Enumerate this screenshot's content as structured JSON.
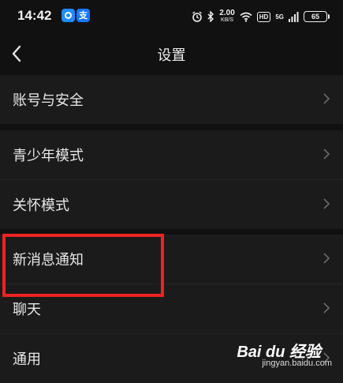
{
  "status_bar": {
    "time": "14:42",
    "app2_glyph": "支",
    "speed_value": "2.00",
    "speed_unit": "KB/S",
    "hd_label": "HD",
    "signal_label": "5G",
    "battery_level": "65",
    "icons": [
      "alarm-icon",
      "bluetooth-icon",
      "wifi-icon",
      "signal-icon"
    ]
  },
  "header": {
    "title": "设置",
    "back_icon": "chevron-left-icon"
  },
  "groups": [
    {
      "items": [
        {
          "label": "账号与安全"
        }
      ]
    },
    {
      "items": [
        {
          "label": "青少年模式"
        },
        {
          "label": "关怀模式"
        }
      ]
    },
    {
      "items": [
        {
          "label": "新消息通知"
        },
        {
          "label": "聊天"
        },
        {
          "label": "通用"
        }
      ]
    }
  ],
  "highlight": {
    "color": "#ee2222",
    "target": "新消息通知"
  },
  "watermark": {
    "logo": "Bai du 经验",
    "url": "jingyan.baidu.com"
  },
  "colors": {
    "background": "#111111",
    "row_background": "#1b1b1b",
    "text": "#e8e8e8",
    "chevron": "#6a6a6a"
  }
}
